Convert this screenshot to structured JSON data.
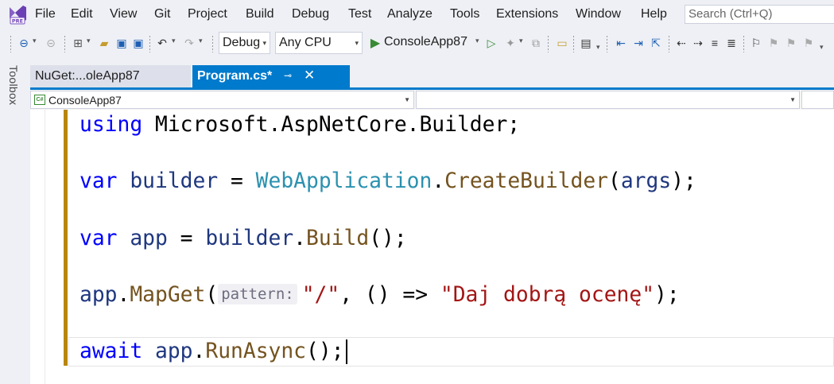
{
  "menu": {
    "items": [
      "File",
      "Edit",
      "View",
      "Git",
      "Project",
      "Build",
      "Debug",
      "Test",
      "Analyze",
      "Tools",
      "Extensions",
      "Window",
      "Help"
    ],
    "search_placeholder": "Search (Ctrl+Q)",
    "logo_badge": "PRE"
  },
  "toolbar": {
    "configuration": "Debug",
    "platform": "Any CPU",
    "run_target": "ConsoleApp87"
  },
  "sidebar": {
    "toolbox_label": "Toolbox"
  },
  "tabs": {
    "inactive_label": "NuGet:...oleApp87",
    "active_label": "Program.cs*",
    "pin_glyph": "⊸",
    "close_glyph": "✕"
  },
  "navbar": {
    "project": "ConsoleApp87",
    "project_icon_text": "C#",
    "member": ""
  },
  "editor": {
    "line1": {
      "kw": "using",
      "rest": " Microsoft.AspNetCore.Builder;"
    },
    "line2": {
      "kw": "var",
      "sp1": " ",
      "var": "builder",
      "eq": " = ",
      "type": "WebApplication",
      "dot": ".",
      "method": "CreateBuilder",
      "open": "(",
      "arg": "args",
      "close": ");"
    },
    "line3": {
      "kw": "var",
      "sp1": " ",
      "var": "app",
      "eq": " = ",
      "var2": "builder",
      "dot": ".",
      "method": "Build",
      "close": "();"
    },
    "line4": {
      "var": "app",
      "dot": ".",
      "method": "MapGet",
      "open": "(",
      "hint": "pattern:",
      "str1": "\"/\"",
      "mid": ", () => ",
      "str2": "\"Daj dobrą ocenę\"",
      "close": ");"
    },
    "line5": {
      "kw": "await",
      "sp1": " ",
      "var": "app",
      "dot": ".",
      "method": "RunAsync",
      "close": "();"
    }
  },
  "colors": {
    "accent": "#007acc",
    "keyword": "#0000ff",
    "type": "#2b91af",
    "method": "#74531f",
    "variable": "#1f377f",
    "string": "#a31515",
    "change_bar": "#b8860b"
  }
}
